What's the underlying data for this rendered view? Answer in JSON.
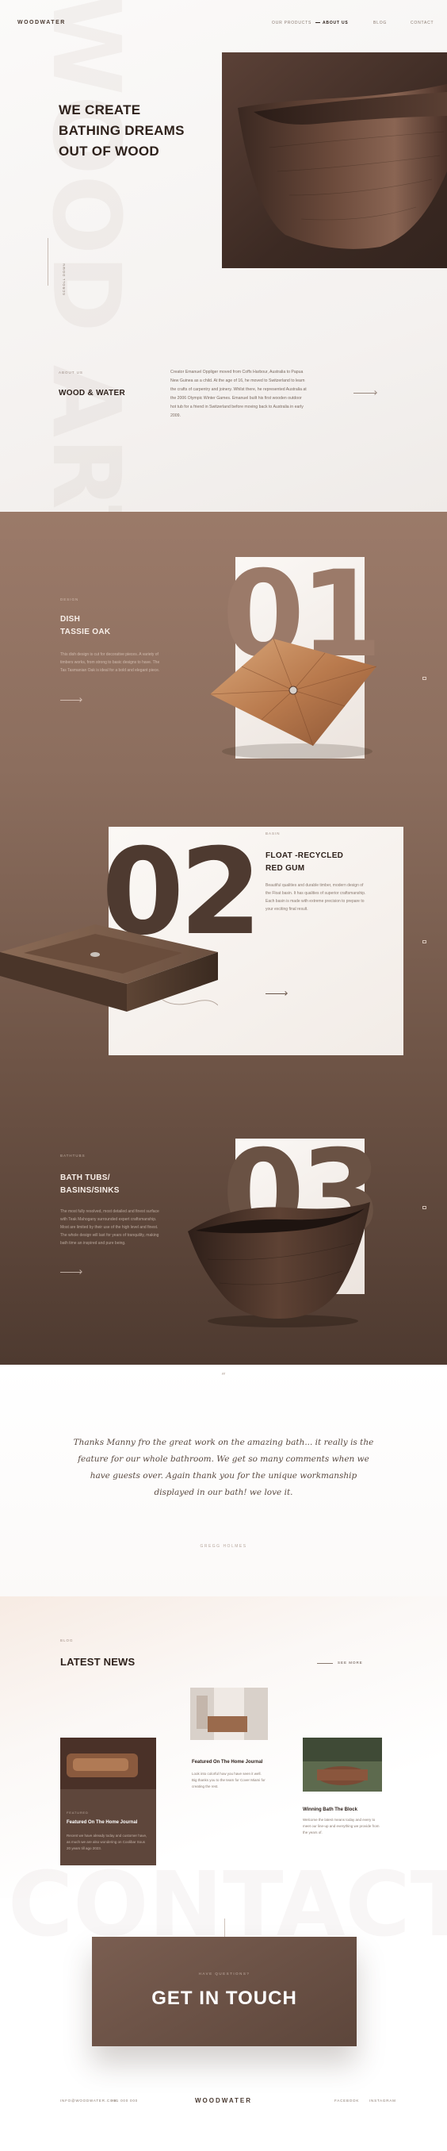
{
  "nav": {
    "logo": "WOODWATER",
    "items": [
      {
        "label": "OUR PRODUCTS"
      },
      {
        "label": "ABOUT US"
      },
      {
        "label": "BLOG"
      },
      {
        "label": "CONTACT"
      }
    ]
  },
  "hero": {
    "ghost_text": "WOOD ART",
    "title_lines": [
      "WE CREATE",
      "BATHING DREAMS",
      "OUT OF WOOD"
    ],
    "vertical_text": "SCROLL DOWN"
  },
  "about": {
    "label": "ABOUT US",
    "title": "WOOD & WATER",
    "text": "Creator Emanuel Oppliger moved from Coffs Harbour, Australia to Papua New Guinea as a child. At the age of 16, he moved to Switzerland to learn the crafts of carpentry and joinery. Whilst there, he represented Australia at the 2006 Olympic Winter Games. Emanuel built his first wooden outdoor hot tub for a friend in Switzerland before moving back to Australia in early 2009."
  },
  "products": [
    {
      "number": "01",
      "small": "DESIGN",
      "title_lines": [
        "DISH",
        "TASSIE OAK"
      ],
      "desc": "This dish design is cut for decorative pieces. A variety of timbers works, from strong to basic designs to have. The Tas Tasmanian Oak is ideal for a bold and elegant piece."
    },
    {
      "number": "02",
      "small": "BASIN",
      "title_lines": [
        "FLOAT -RECYCLED",
        "RED GUM"
      ],
      "desc": "Beautiful qualities and durable timber, modern design of the Float basin. It has qualities of superior craftsmanship. Each basin is made with extreme precision to prepare to your exciting final result."
    },
    {
      "number": "03",
      "small": "BATHTUBS",
      "title_lines": [
        "BATH TUBS/",
        "BASINS/SINKS"
      ],
      "desc": "The most fully resolved, most detailed and finest surface with Teak Mahogany surrounded expert craftsmanship. Most are limited by their use of the high level and finest. The whole design will last for years of tranquility, making bath time an inspired and pure being."
    }
  ],
  "testimonial": {
    "quote_mark": "“",
    "text": "Thanks Manny fro the great work on the amazing bath... it really is the feature for our whole bathroom. We get so many comments when we have guests over. Again thank you for the unique workmanship displayed in our bath! we love it.",
    "author": "GREGG HOLMES"
  },
  "news": {
    "small": "BLOG",
    "title": "LATEST NEWS",
    "see_more": "SEE MORE",
    "cards": [
      {
        "small": "FEATURED",
        "title": "Featured On The Home Journal",
        "desc": "Recent we have already today and customer have, as much we are also wondering on Coolibar Sous 20 years till ago 2023."
      },
      {
        "small": "FEATURED",
        "title": "Featured On The Home Journal",
        "desc": "Look into colorful how you have seen it well. Big thanks you to the team for Cover Miami for creating the rest."
      },
      {
        "small": "UPDATES",
        "title": "Winning Bath The Block",
        "desc": "Welcome the latest means today and every to meet our line-up and everything we provide from the years of."
      }
    ]
  },
  "contact": {
    "ghost_text": "CONTACT",
    "small": "HAVE QUESTIONS?",
    "title": "GET IN TOUCH"
  },
  "footer": {
    "logo": "WOODWATER",
    "left_items": [
      "INFO@WOODWATER.COM",
      "+61 000 000"
    ],
    "right_items": [
      "FACEBOOK",
      "INSTAGRAM"
    ]
  }
}
